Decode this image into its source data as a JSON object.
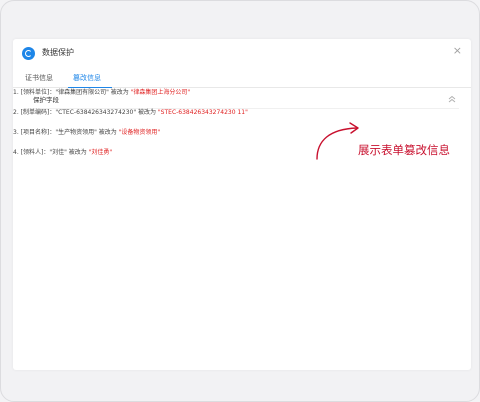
{
  "dialog": {
    "title": "数据保护",
    "close_glyph": "×"
  },
  "tabs": [
    {
      "label": "证书信息",
      "active": false
    },
    {
      "label": "篡改信息",
      "active": true
    }
  ],
  "section": {
    "title": "保护字段"
  },
  "changes": [
    {
      "prefix": "1. [领料单位]：\"律森集团有限公司\" 被改为 ",
      "new_value": "\"律森集团上海分公司\""
    },
    {
      "prefix": "2. [制单编码]：\"CTEC-638426343274230\" 被改为 ",
      "new_value": "\"STEC-638426343274230 11\""
    },
    {
      "prefix": "3. [项目名称]：\"生产物资领用\" 被改为 ",
      "new_value": "\"设备物资领用\""
    },
    {
      "prefix": "4. [领料人]：\"刘佳\" 被改为 ",
      "new_value": "\"刘佳勇\""
    }
  ],
  "annotation": {
    "text": "展示表单篡改信息"
  },
  "colors": {
    "accent": "#1e86e8",
    "changed_value": "#e02020",
    "annotation": "#c8102e"
  },
  "icons": {
    "logo": "app-logo-icon",
    "collapse": "chevron-double-up-icon",
    "close": "close-icon"
  }
}
